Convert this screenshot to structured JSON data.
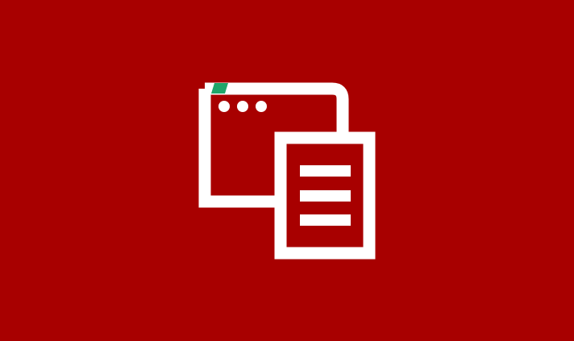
{
  "illustration": {
    "icon": "browser-window-with-document-icon",
    "colors": {
      "background": "#a80000",
      "foreground": "#ffffff",
      "accent": "#1fa66a"
    }
  }
}
